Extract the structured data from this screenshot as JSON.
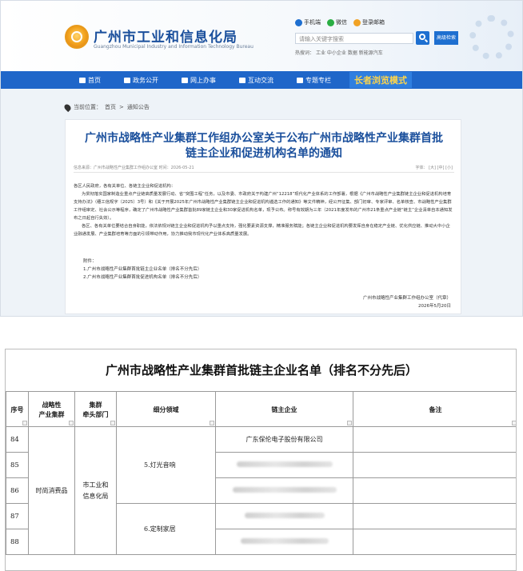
{
  "site": {
    "title": "广州市工业和信息化局",
    "subtitle": "Guangzhou Municipal Industry and Information Technology Bureau",
    "top_links": [
      "手机端",
      "微信",
      "登录邮箱"
    ],
    "search_placeholder": "请输入关键字搜索",
    "adv_search": "高级检索",
    "hot_label": "热搜词：",
    "hot_words": [
      "工业",
      "中小企业",
      "数据",
      "新能源汽车"
    ]
  },
  "colors": {
    "brand": "#1f66c9",
    "title": "#1a4f9c",
    "elder": "#ffd54a"
  },
  "nav": {
    "items": [
      {
        "label": "首页",
        "icon": "home-icon"
      },
      {
        "label": "政务公开",
        "icon": "briefcase-icon"
      },
      {
        "label": "网上办事",
        "icon": "monitor-icon"
      },
      {
        "label": "互动交流",
        "icon": "chat-icon"
      },
      {
        "label": "专题专栏",
        "icon": "folder-icon"
      }
    ],
    "elder_mode": "长者浏览模式"
  },
  "breadcrumb": {
    "label": "当前位置：",
    "items": [
      "首页",
      "通知公告"
    ]
  },
  "article": {
    "title": "广州市战略性产业集群工作组办公室关于公布广州市战略性产业集群首批链主企业和促进机构名单的通知",
    "meta": "信息来源：广州市战略性产业集群工作组办公室  时间：2026-05-21",
    "font_label": "字体：",
    "font_sizes": [
      "[大]",
      "[中]",
      "[小]"
    ],
    "greeting": "各区人民政府，各有关单位、各链主企业和促进机构：",
    "para1": "为贯彻落实国家制造业重点产业链高质量发展行动、省“突围工程”任务，以及市委、市政府关于构建广州“12218”现代化产业体系的工作部署，根据《广州市战略性产业集群链主企业和促进机构培育支持办法》（穗工信规字〔2025〕3号）和《关于开展2025年广州市战略性产业集群链主企业和促进机构遴选工作的通知》等文件精神，经公开征集、部门初审、专家评审、名单核查、市战略性产业集群工作组审定、社会公示等程序，确定了广州市战略性产业集群首批89家链主企业和30家促进机构名单，现予公布。称号有效期为三年（2021年度发布的广州市21条重点产业链“链主”企业清单自本通知发布之日起自行失效）。",
    "para2": "各区、各有关单位要结合自身职能，依法依规对链主企业和促进机构予以重点支持，强化要素资源支撑，精准服务赋能；各链主企业和促进机构要发挥自身在稳定产业链、优化供应链、推动大中小企业融通发展、产业集群培育等方面的引领带动作用，协力推动我市现代化产业体系高质量发展。",
    "attach_label": "附件：",
    "attachments": [
      "1.广州市战略性产业集群首批链主企业名单（排名不分先后）",
      "2.广州市战略性产业集群首批促进机构名单（排名不分先后）"
    ],
    "signer": "广州市战略性产业集群工作组办公室（代章）",
    "sign_date": "2026年5月20日"
  },
  "table": {
    "title": "广州市战略性产业集群首批链主企业名单（排名不分先后）",
    "headers": [
      "序号",
      "战略性\n产业集群",
      "集群\n牵头部门",
      "细分领域",
      "链主企业",
      "备注"
    ],
    "cluster": "时尚消费品",
    "department": "市工业和\n信息化局",
    "rows": [
      {
        "no": "84",
        "company": "广东保伦电子股份有限公司"
      },
      {
        "no": "85",
        "company": ""
      },
      {
        "no": "86",
        "company": ""
      },
      {
        "no": "87",
        "company": ""
      },
      {
        "no": "88",
        "company": ""
      }
    ],
    "subfields": [
      "5.灯光音响",
      "6.定制家居"
    ]
  }
}
